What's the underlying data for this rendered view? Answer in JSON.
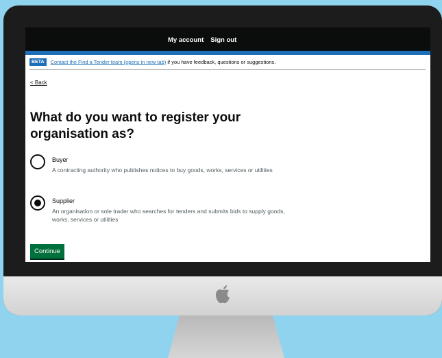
{
  "header": {
    "my_account": "My account",
    "sign_out": "Sign out"
  },
  "beta": {
    "tag": "BETA",
    "link": "Contact the Find a Tender team (opens in new tab)",
    "text": "if you have feedback, questions or suggestions."
  },
  "back_link": "< Back",
  "title": "What do you want to register your organisation as?",
  "options": [
    {
      "label": "Buyer",
      "hint": "A contracting authority who publishes notices to buy goods, works, services or utilities",
      "selected": false
    },
    {
      "label": "Supplier",
      "hint": "An organisation or sole trader who searches for tenders and submits bids to supply goods, works, services or utilities",
      "selected": true
    }
  ],
  "continue_label": "Continue",
  "icons": {
    "logo": "apple-logo-icon"
  },
  "colors": {
    "background": "#8fd3ef",
    "header": "#0b0c0c",
    "accent": "#1d70b8",
    "button": "#00703c"
  }
}
